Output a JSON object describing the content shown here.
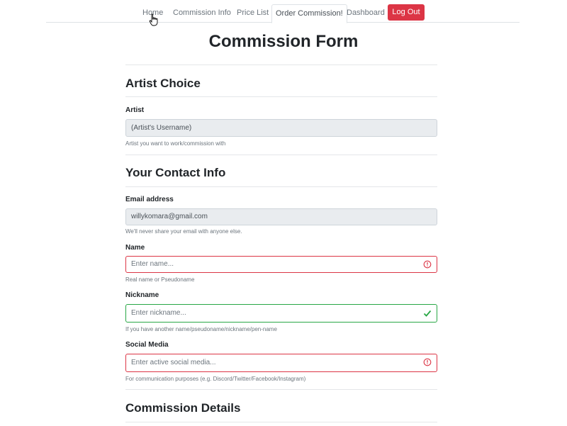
{
  "nav": {
    "links": [
      "Home",
      "Commission Info",
      "Price List",
      "Order Commission!",
      "Dashboard"
    ],
    "logout_label": "Log Out",
    "logout_color": "#dc3545"
  },
  "page_title": "Commission Form",
  "artist_section": {
    "heading": "Artist Choice",
    "artist_label": "Artist",
    "artist_value": "(Artist's Username)",
    "artist_help": "Artist you want to work/commission with"
  },
  "contact_section": {
    "heading": "Your Contact Info",
    "email_label": "Email address",
    "email_value": "willykomara@gmail.com",
    "email_help": "We'll never share your email with anyone else.",
    "name_label": "Name",
    "name_placeholder": "Enter name...",
    "name_help": "Real name or Pseudoname",
    "nickname_label": "Nickname",
    "nickname_placeholder": "Enter nickname...",
    "nickname_help": "If you have another name/pseudoname/nickname/pen-name",
    "social_label": "Social Media",
    "social_placeholder": "Enter active social media...",
    "social_help": "For communication purposes (e.g. Discord/Twitter/Facebook/Instagram)"
  },
  "details_section": {
    "heading": "Commission Details"
  },
  "colors": {
    "invalid": "#dc3545",
    "valid": "#28a745"
  }
}
